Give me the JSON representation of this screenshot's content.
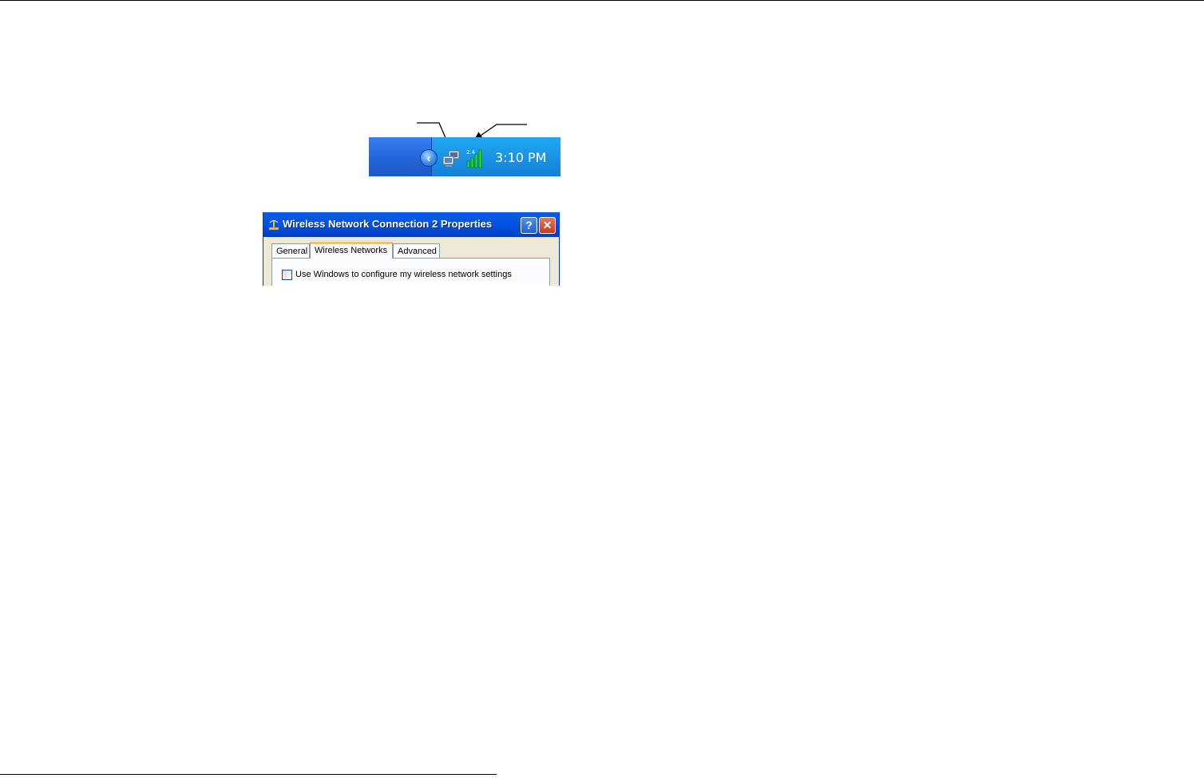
{
  "taskbar": {
    "clock": "3:10 PM",
    "signal_badge": "2.4",
    "icons": [
      "chevron-left-icon",
      "network-computers-icon",
      "signal-bars-icon"
    ]
  },
  "dialog": {
    "title": "Wireless Network Connection 2 Properties",
    "help_label": "?",
    "close_label": "✕",
    "tabs": [
      "General",
      "Wireless Networks",
      "Advanced"
    ],
    "active_tab": "Wireless Networks",
    "checkbox": {
      "label": "Use Windows to configure my wireless network settings",
      "checked": false
    }
  },
  "colors": {
    "taskbar_blue": "#2a74e6",
    "tray_blue": "#1a94e6",
    "title_blue": "#0054e3",
    "dialog_face": "#ece9d8",
    "active_tab_accent": "#ffc83c",
    "close_red": "#c53b1a"
  }
}
